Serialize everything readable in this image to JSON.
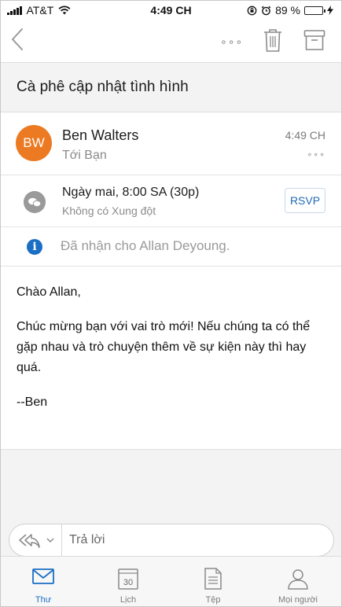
{
  "status_bar": {
    "carrier": "AT&T",
    "time": "4:49 CH",
    "battery_percent": "89 %",
    "battery_level": 0.89
  },
  "nav": {
    "more_label": "∘∘∘"
  },
  "email": {
    "subject": "Cà phê cập nhật tình hình",
    "sender_initials": "BW",
    "sender_name": "Ben Walters",
    "recipient": "Tới Bạn",
    "sent_time": "4:49 CH",
    "meeting_time": "Ngày mai, 8:00 SA (30p)",
    "meeting_conflict": "Không có Xung đột",
    "rsvp_label": "RSVP",
    "info_text": "Đã nhận cho Allan Deyoung.",
    "body": {
      "greeting": "Chào Allan,",
      "line1": "Chúc mừng bạn với vai trò mới! Nếu chúng ta có thể gặp nhau và trò chuyện thêm về sự kiện này thì hay quá.",
      "signature": "--Ben"
    }
  },
  "reply": {
    "placeholder": "Trả lời"
  },
  "tabs": [
    {
      "label": "Thư",
      "icon": "mail-icon",
      "active": true
    },
    {
      "label": "Lịch",
      "icon": "calendar-icon",
      "calendar_day": "30",
      "active": false
    },
    {
      "label": "Tệp",
      "icon": "file-icon",
      "active": false
    },
    {
      "label": "Mọi người",
      "icon": "people-icon",
      "active": false
    }
  ],
  "colors": {
    "accent": "#1a6ec4",
    "avatar": "#ec7a22",
    "battery": "#3cc23c"
  }
}
